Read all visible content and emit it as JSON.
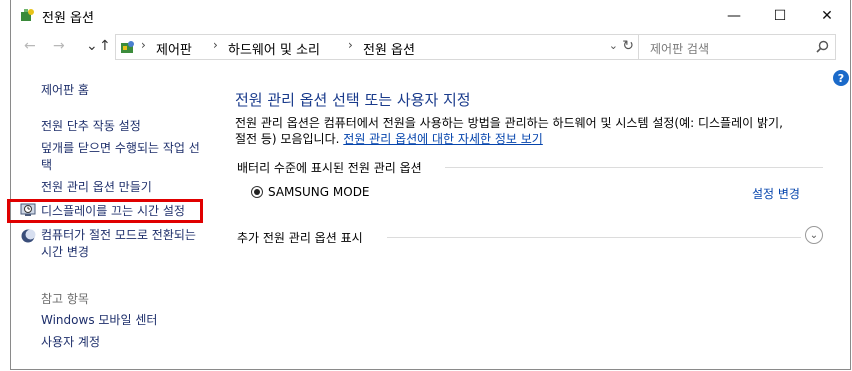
{
  "window": {
    "title": "전원 옵션",
    "minimize": "—",
    "maximize": "☐",
    "close": "✕"
  },
  "nav": {
    "back": "←",
    "forward": "→",
    "up": "↑",
    "breadcrumb": [
      "제어판",
      "하드웨어 및 소리",
      "전원 옵션"
    ],
    "sep": "›",
    "dropdown": "⌄",
    "refresh": "↻"
  },
  "search": {
    "placeholder": "제어판 검색"
  },
  "sidebar": {
    "home": "제어판 홈",
    "items": [
      {
        "label": "전원 단추 작동 설정"
      },
      {
        "label": "덮개를 닫으면 수행되는 작업 선택"
      },
      {
        "label": "전원 관리 옵션 만들기"
      },
      {
        "label": "디스플레이를 끄는 시간 설정"
      },
      {
        "label": "컴퓨터가 절전 모드로 전환되는 시간 변경"
      }
    ],
    "see_also_title": "참고 항목",
    "see_also": [
      {
        "label": "Windows 모바일 센터"
      },
      {
        "label": "사용자 계정"
      }
    ]
  },
  "main": {
    "heading": "전원 관리 옵션 선택 또는 사용자 지정",
    "description": "전원 관리 옵션은 컴퓨터에서 전원을 사용하는 방법을 관리하는 하드웨어 및 시스템 설정(예: 디스플레이 밝기, 절전 등) 모음입니다.",
    "more_info_link": "전원 관리 옵션에 대한 자세한 정보 보기",
    "battery_group": "배터리 수준에 표시된 전원 관리 옵션",
    "plan_name": "SAMSUNG MODE",
    "change_link": "설정 변경",
    "more_plans": "추가 전원 관리 옵션 표시",
    "expand": "⌄"
  },
  "help": "?",
  "colors": {
    "link": "#1e2f6b",
    "heading": "#1a3b8c",
    "highlight": "#e00000",
    "help_bg": "#1b6ac9"
  }
}
